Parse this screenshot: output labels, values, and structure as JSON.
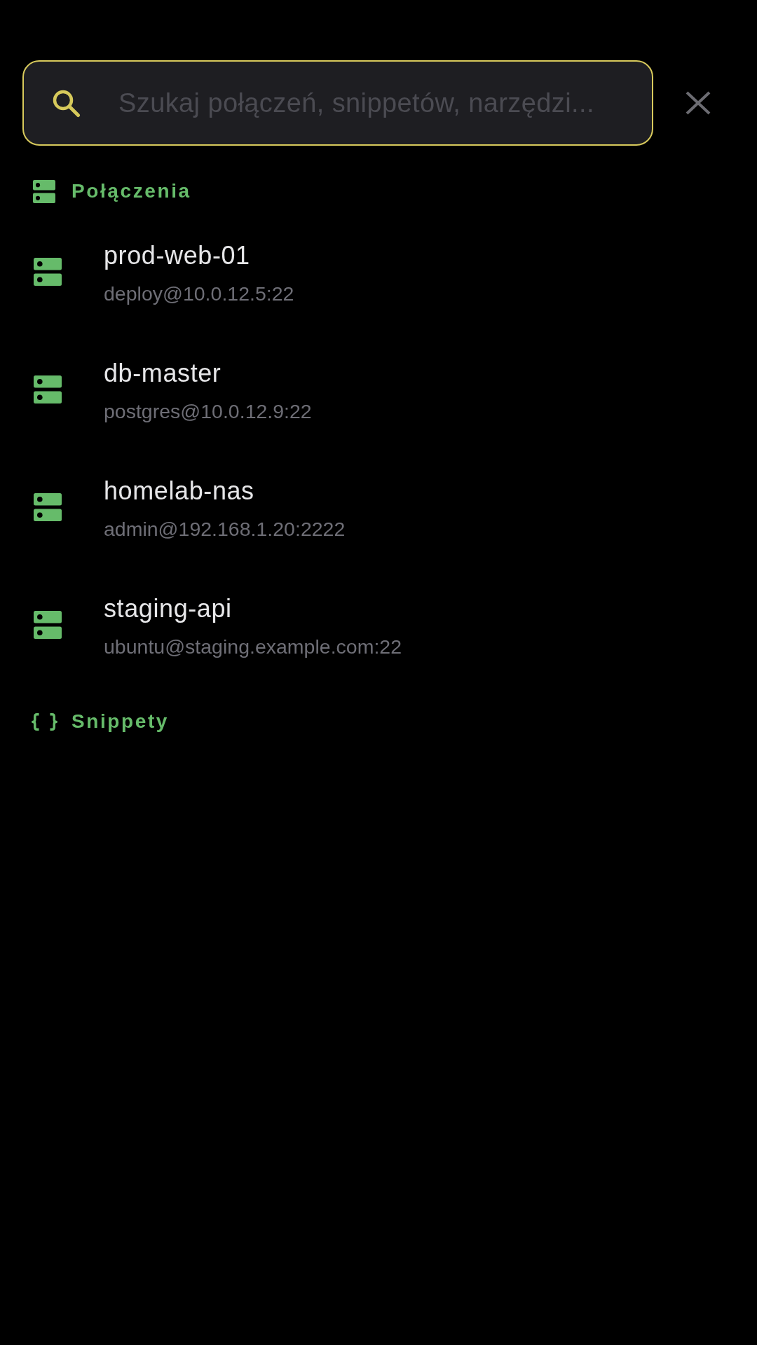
{
  "search": {
    "placeholder": "Szukaj połączeń, snippetów, narzędzi...",
    "focused": true
  },
  "sections": [
    {
      "kind": "connections",
      "title": "Połączenia",
      "items": [
        {
          "name": "prod-web-01",
          "address": "deploy@10.0.12.5:22"
        },
        {
          "name": "db-master",
          "address": "postgres@10.0.12.9:22"
        },
        {
          "name": "homelab-nas",
          "address": "admin@192.168.1.20:2222"
        },
        {
          "name": "staging-api",
          "address": "ubuntu@staging.example.com:22"
        }
      ]
    },
    {
      "kind": "snippets",
      "title": "Snippety"
    }
  ]
}
